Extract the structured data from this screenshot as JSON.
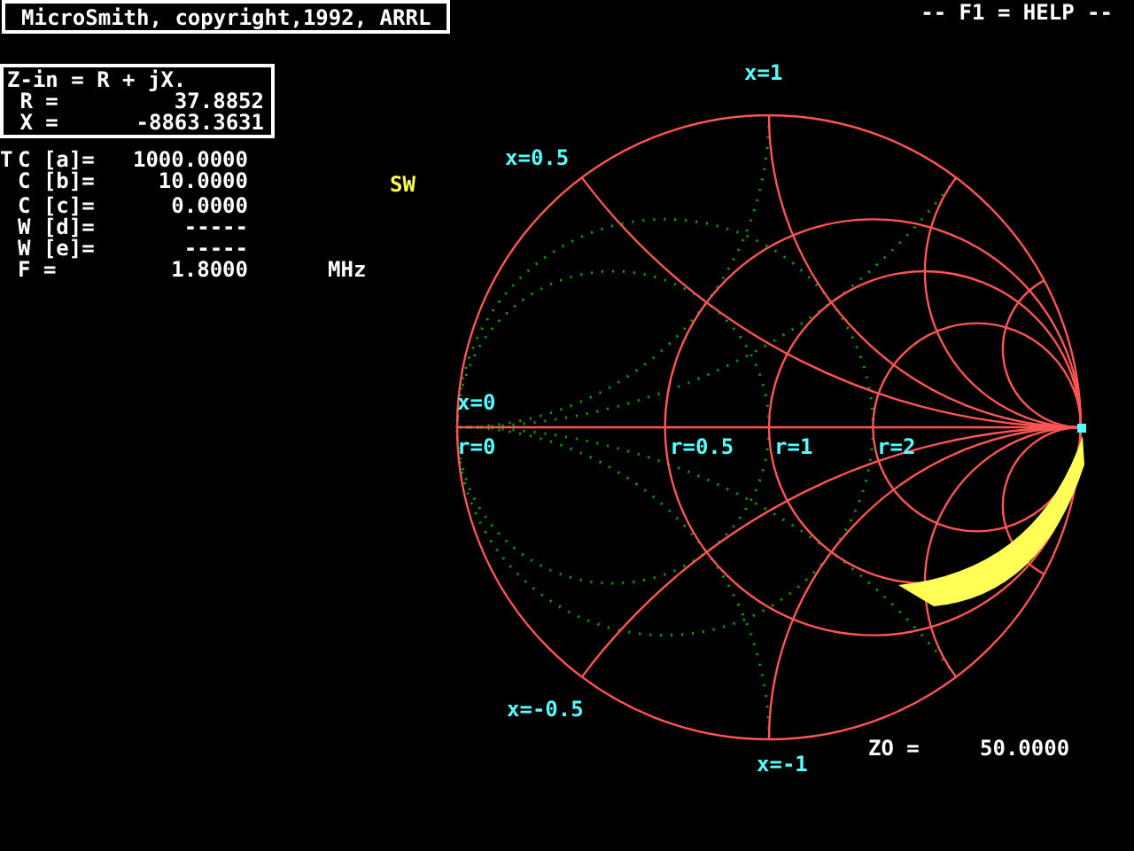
{
  "title": "MicroSmith, copyright,1992, ARRL",
  "help": "-- F1 = HELP --",
  "impedance": {
    "heading": "Z-in = R + jX.",
    "rows": [
      {
        "label": "R =",
        "value": "37.8852"
      },
      {
        "label": "X =",
        "value": "-8863.3631"
      }
    ]
  },
  "parameters": [
    {
      "prefix": "T",
      "label": "C [a]=",
      "value": "1000.0000"
    },
    {
      "label": "C [b]=",
      "value": "10.0000",
      "flag": "SW"
    },
    {
      "label": "C [c]=",
      "value": "0.0000"
    },
    {
      "label": "W [d]=",
      "value": "-----"
    },
    {
      "label": "W [e]=",
      "value": "-----"
    },
    {
      "label": "F =",
      "value": "1.8000",
      "unit": "MHz"
    }
  ],
  "chart": {
    "labels": [
      "x=1",
      "x=0.5",
      "x=0",
      "r=0",
      "r=0.5",
      "r=1",
      "r=2",
      "x=-0.5",
      "x=-1"
    ],
    "z0": {
      "label": "ZO =",
      "value": "50.0000"
    }
  }
}
